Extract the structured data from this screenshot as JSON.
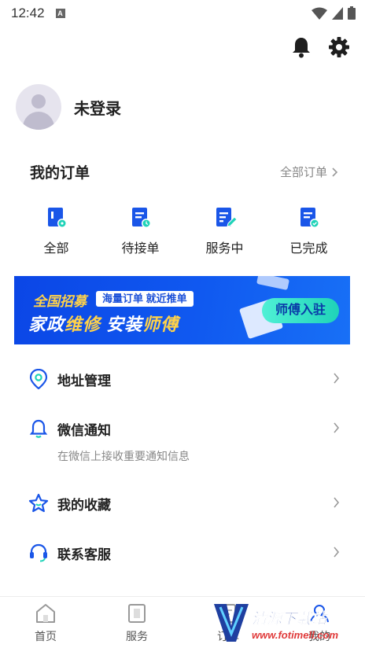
{
  "status_bar": {
    "time": "12:42",
    "notif_letter": "A"
  },
  "profile": {
    "login_status": "未登录"
  },
  "orders": {
    "title": "我的订单",
    "all_link": "全部订单",
    "statuses": [
      {
        "label": "全部",
        "icon": "order-all-icon"
      },
      {
        "label": "待接单",
        "icon": "order-pending-icon"
      },
      {
        "label": "服务中",
        "icon": "order-in-service-icon"
      },
      {
        "label": "已完成",
        "icon": "order-completed-icon"
      }
    ]
  },
  "banner": {
    "badge": "全国招募",
    "tag": "海量订单 就近推单",
    "slogan_a": "家政",
    "slogan_b": "维修",
    "slogan_c": " 安装",
    "slogan_d": "师傅",
    "button": "师傅入驻"
  },
  "menu": {
    "address": "地址管理",
    "wechat": "微信通知",
    "wechat_sub": "在微信上接收重要通知信息",
    "favorites": "我的收藏",
    "support": "联系客服"
  },
  "bottom_nav": [
    {
      "label": "首页"
    },
    {
      "label": "服务"
    },
    {
      "label": "订单"
    },
    {
      "label": "我的"
    }
  ],
  "watermark": {
    "name": "清源下载站",
    "url": "www.fotimell.com"
  },
  "colors": {
    "accent": "#1a56e8",
    "teal": "#1fd3b8",
    "gold": "#ffd24a"
  }
}
